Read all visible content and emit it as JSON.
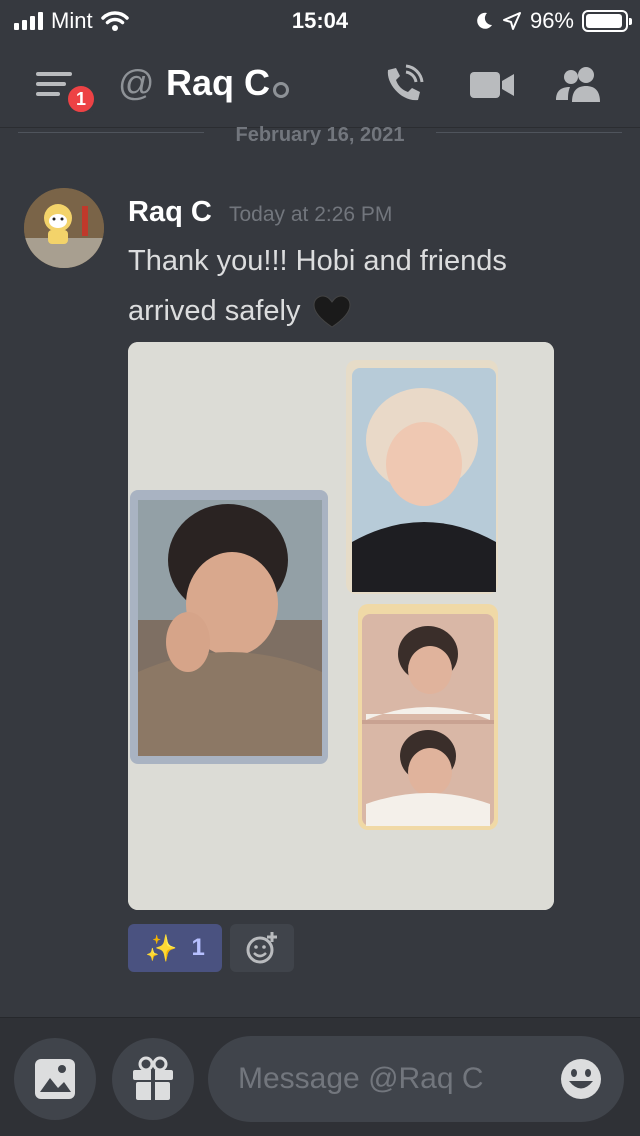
{
  "status_bar": {
    "carrier": "Mint",
    "time": "15:04",
    "battery": "96%",
    "battery_level": 0.96
  },
  "header": {
    "channel_name": "Raq C",
    "notification_count": "1",
    "icons": [
      "menu-icon",
      "at-icon",
      "call-icon",
      "video-icon",
      "members-icon"
    ]
  },
  "divider": {
    "date": "February 16, 2021"
  },
  "message": {
    "author": "Raq C",
    "timestamp": "Today at 2:26 PM",
    "text": "Thank you!!! Hobi and friends arrived safely",
    "emoji": "black-heart",
    "attachment": "photo of three photocards"
  },
  "reactions": [
    {
      "emoji": "✨",
      "count": "1"
    }
  ],
  "composer": {
    "placeholder": "Message @Raq C",
    "icons": [
      "image-icon",
      "gift-icon",
      "emoji-icon"
    ]
  },
  "colors": {
    "background": "#36393f",
    "composer": "#2f3136",
    "reaction": "#4a5280",
    "badge": "#ed4245",
    "muted": "#72767d"
  }
}
